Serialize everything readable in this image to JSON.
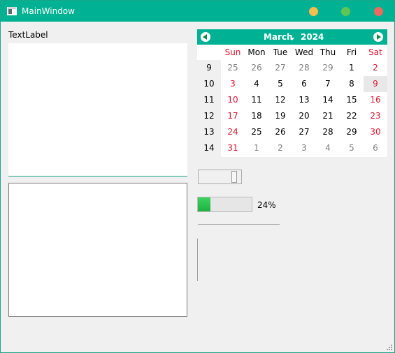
{
  "window": {
    "title": "MainWindow",
    "accent": "#00b293"
  },
  "label": {
    "text": "TextLabel"
  },
  "calendar": {
    "month": "March",
    "year": "2024",
    "weekdays": [
      "Sun",
      "Mon",
      "Tue",
      "Wed",
      "Thu",
      "Fri",
      "Sat"
    ],
    "weeks": [
      {
        "num": "9",
        "days": [
          "25",
          "26",
          "27",
          "28",
          "29",
          "1",
          "2"
        ]
      },
      {
        "num": "10",
        "days": [
          "3",
          "4",
          "5",
          "6",
          "7",
          "8",
          "9"
        ]
      },
      {
        "num": "11",
        "days": [
          "10",
          "11",
          "12",
          "13",
          "14",
          "15",
          "16"
        ]
      },
      {
        "num": "12",
        "days": [
          "17",
          "18",
          "19",
          "20",
          "21",
          "22",
          "23"
        ]
      },
      {
        "num": "13",
        "days": [
          "24",
          "25",
          "26",
          "27",
          "28",
          "29",
          "30"
        ]
      },
      {
        "num": "14",
        "days": [
          "31",
          "1",
          "2",
          "3",
          "4",
          "5",
          "6"
        ]
      }
    ],
    "selected_day": "9"
  },
  "progress": {
    "value": 0.24,
    "text": "24%"
  }
}
